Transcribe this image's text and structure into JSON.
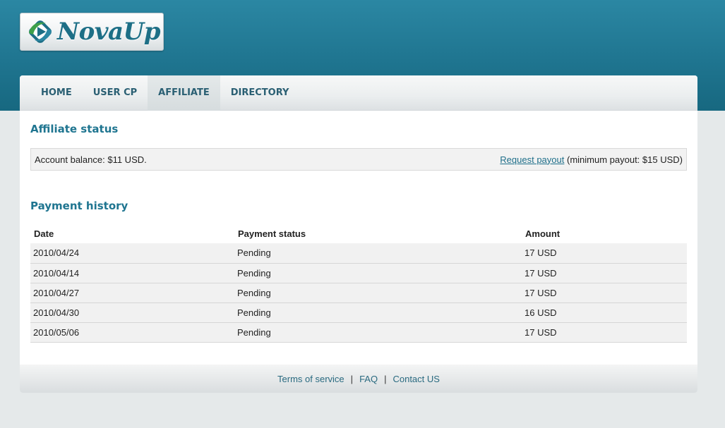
{
  "brand": {
    "name": "NovaUp",
    "colors": {
      "primary": "#1f7590",
      "logo_green": "#3ea04a",
      "logo_blue": "#1d6f86"
    }
  },
  "nav": {
    "items": [
      {
        "label": "HOME",
        "active": false
      },
      {
        "label": "USER CP",
        "active": false
      },
      {
        "label": "AFFILIATE",
        "active": true
      },
      {
        "label": "DIRECTORY",
        "active": false
      }
    ]
  },
  "affiliate": {
    "title": "Affiliate status",
    "balance_text": "Account balance: $11 USD.",
    "payout_link": "Request payout",
    "payout_note": " (minimum payout: $15 USD)"
  },
  "payments": {
    "title": "Payment history",
    "columns": [
      "Date",
      "Payment status",
      "Amount"
    ],
    "rows": [
      [
        "2010/04/24",
        "Pending",
        "17 USD"
      ],
      [
        "2010/04/14",
        "Pending",
        "17 USD"
      ],
      [
        "2010/04/27",
        "Pending",
        "17 USD"
      ],
      [
        "2010/04/30",
        "Pending",
        "16 USD"
      ],
      [
        "2010/05/06",
        "Pending",
        "17 USD"
      ]
    ]
  },
  "footer": {
    "links": [
      "Terms of service",
      "FAQ",
      "Contact US"
    ],
    "separator": "|"
  }
}
